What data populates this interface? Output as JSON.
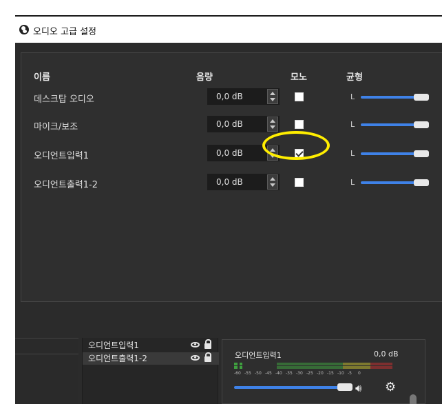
{
  "window": {
    "title": "오디오 고급 설정"
  },
  "headers": {
    "name": "이름",
    "volume": "음량",
    "mono": "모노",
    "balance": "균형"
  },
  "rows": [
    {
      "name": "데스크탑 오디오",
      "volume": "0,0 dB",
      "mono": false,
      "balance_label": "L"
    },
    {
      "name": "마이크/보조",
      "volume": "0,0 dB",
      "mono": false,
      "balance_label": "L"
    },
    {
      "name": "오디언트입력1",
      "volume": "0,0 dB",
      "mono": true,
      "balance_label": "L"
    },
    {
      "name": "오디언트출력1-2",
      "volume": "0,0 dB",
      "mono": false,
      "balance_label": "L"
    }
  ],
  "sources": [
    {
      "name": "오디언트입력1"
    },
    {
      "name": "오디언트출력1-2"
    }
  ],
  "mixer": {
    "channel": "오디언트입력1",
    "db": "0,0 dB",
    "ticks": [
      "-60",
      "-55",
      "-50",
      "-45",
      "-40",
      "-35",
      "-30",
      "-25",
      "-20",
      "-15",
      "-10",
      "-5",
      "0"
    ]
  },
  "colors": {
    "accent": "#3f82e8",
    "highlight_ring": "#ffee00"
  },
  "icons": {
    "app": "obs-logo-icon",
    "spin": "spinbox-arrows-icon",
    "visibility": "eye-icon",
    "lock": "lock-icon",
    "speaker": "speaker-icon",
    "settings": "gear-icon"
  }
}
